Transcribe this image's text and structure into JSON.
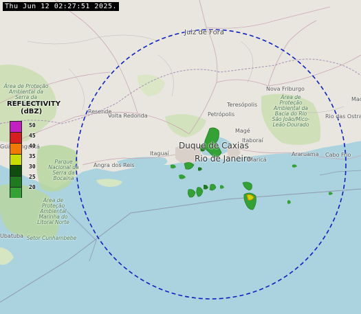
{
  "timestamp": "Thu Jun 12 02:27:51 2025.",
  "legend": {
    "title_line1": "REFLECTIVITY",
    "title_line2": "(dBZ)",
    "levels": [
      {
        "value": "50",
        "color": "#c21ec2"
      },
      {
        "value": "45",
        "color": "#d61e1e"
      },
      {
        "value": "40",
        "color": "#f07a00"
      },
      {
        "value": "35",
        "color": "#c8dc00"
      },
      {
        "value": "30",
        "color": "#0f4d0f"
      },
      {
        "value": "25",
        "color": "#1f7a1f"
      },
      {
        "value": "20",
        "color": "#33a133"
      }
    ]
  },
  "places": {
    "juiz_de_fora": "Juiz de Fora",
    "nova_friburgo": "Nova Friburgo",
    "teresopolis": "Teresópolis",
    "petropolis": "Petrópolis",
    "volta_redonda": "Volta Redonda",
    "resende": "Resende",
    "mage": "Magé",
    "duque_de_caxias": "Duque de Caxias",
    "rio_de_janeiro": "Rio de Janeiro",
    "itaborai": "Itaboraí",
    "marica": "Maricá",
    "araruama": "Araruama",
    "cabo_frio": "Cabo Frio",
    "rio_das_ostras": "Rio das Ostras",
    "itaguai": "Itaguaí",
    "angra_dos_reis": "Angra dos Reis",
    "ubatuba": "Ubatuba",
    "guaratingueta": "Guaratinguetá",
    "mac": "Mac",
    "area_protecao_nw": "Área de Proteção Ambiental da Serra da Mantiqueira",
    "parque_serra_bocaina": "Parque Nacional da Serra da Bocaina",
    "area_protecao_sw": "Área de Proteção Ambiental Marinha do Litoral Norte",
    "setor_cunhambebe": "Setor Cunhambebe",
    "area_protecao_ne": "Área de Proteção Ambiental da Bacia do Rio São João/Mico-Leão-Dourado"
  },
  "icons": {
    "radar_range": "radar-range-circle",
    "echo": "precipitation-echo"
  }
}
